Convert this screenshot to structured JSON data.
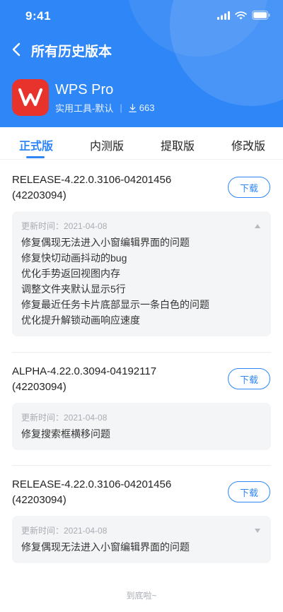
{
  "status_bar": {
    "time": "9:41"
  },
  "nav": {
    "title": "所有历史版本"
  },
  "app": {
    "name": "WPS Pro",
    "category": "实用工具-默认",
    "separator": "|",
    "downloads": "663"
  },
  "tabs": [
    {
      "label": "正式版",
      "active": true
    },
    {
      "label": "内测版",
      "active": false
    },
    {
      "label": "提取版",
      "active": false
    },
    {
      "label": "修改版",
      "active": false
    }
  ],
  "versions": [
    {
      "name": "RELEASE-4.22.0.3106-04201456",
      "code": "(42203094)",
      "download_label": "下载",
      "date_label": "更新时间：2021-04-08",
      "expanded": true,
      "notes": [
        "修复偶现无法进入小窗编辑界面的问题",
        "修复快切动画抖动的bug",
        "优化手势返回视图内存",
        "调整文件夹默认显示5行",
        "修复最近任务卡片底部显示一条白色的问题",
        "优化提升解锁动画响应速度"
      ]
    },
    {
      "name": "ALPHA-4.22.0.3094-04192117",
      "code": "(42203094)",
      "download_label": "下载",
      "date_label": "更新时间：2021-04-08",
      "notes": [
        "修复搜索框横移问题"
      ]
    },
    {
      "name": "RELEASE-4.22.0.3106-04201456",
      "code": "(42203094)",
      "download_label": "下载",
      "date_label": "更新时间：2021-04-08",
      "expanded": false,
      "notes": [
        "修复偶现无法进入小窗编辑界面的问题"
      ]
    }
  ],
  "footer": {
    "text": "到底啦~"
  },
  "colors": {
    "accent": "#2f86f6",
    "logo": "#e7332c",
    "notes_bg": "#f4f5f7"
  }
}
